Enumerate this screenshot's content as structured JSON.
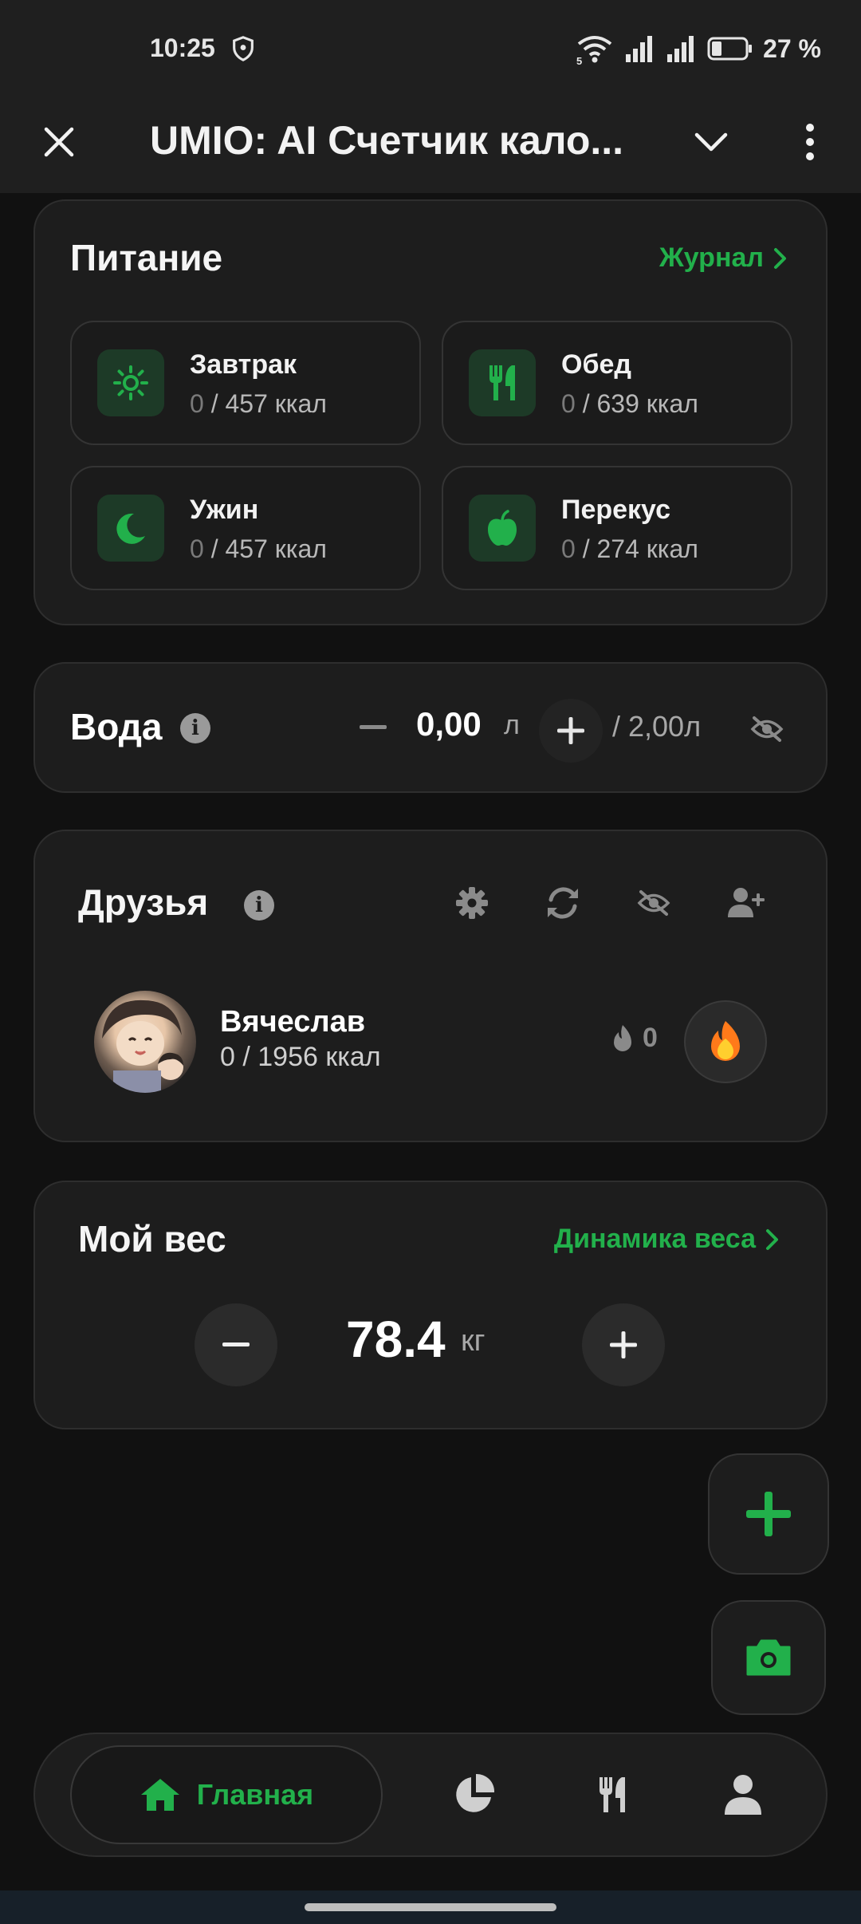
{
  "status_bar": {
    "time": "10:25",
    "battery_text": "27 %",
    "network_label": "5"
  },
  "app_bar": {
    "title": "UMIO: AI Счетчик кало..."
  },
  "nutrition": {
    "title": "Питание",
    "journal_link": "Журнал",
    "meals": [
      {
        "name": "Завтрак",
        "eaten": "0",
        "goal": " / 457 ккал",
        "icon": "sun-icon"
      },
      {
        "name": "Обед",
        "eaten": "0",
        "goal": " / 639 ккал",
        "icon": "utensils-icon"
      },
      {
        "name": "Ужин",
        "eaten": "0",
        "goal": " / 457 ккал",
        "icon": "moon-icon"
      },
      {
        "name": "Перекус",
        "eaten": "0",
        "goal": " / 274 ккал",
        "icon": "apple-icon"
      }
    ]
  },
  "water": {
    "title": "Вода",
    "value": "0,00",
    "unit": "л",
    "goal": "/ 2,00л"
  },
  "friends": {
    "title": "Друзья",
    "list": [
      {
        "name": "Вячеслав",
        "kcal": "0 / 1956 ккал",
        "streak": "0"
      }
    ]
  },
  "weight": {
    "title": "Мой вес",
    "dynamics_link": "Динамика веса",
    "value": "78.4",
    "unit": "кг"
  },
  "bottom_nav": {
    "home_label": "Главная"
  },
  "colors": {
    "accent": "#22b04b",
    "background": "#111111",
    "card": "#1d1d1d"
  }
}
